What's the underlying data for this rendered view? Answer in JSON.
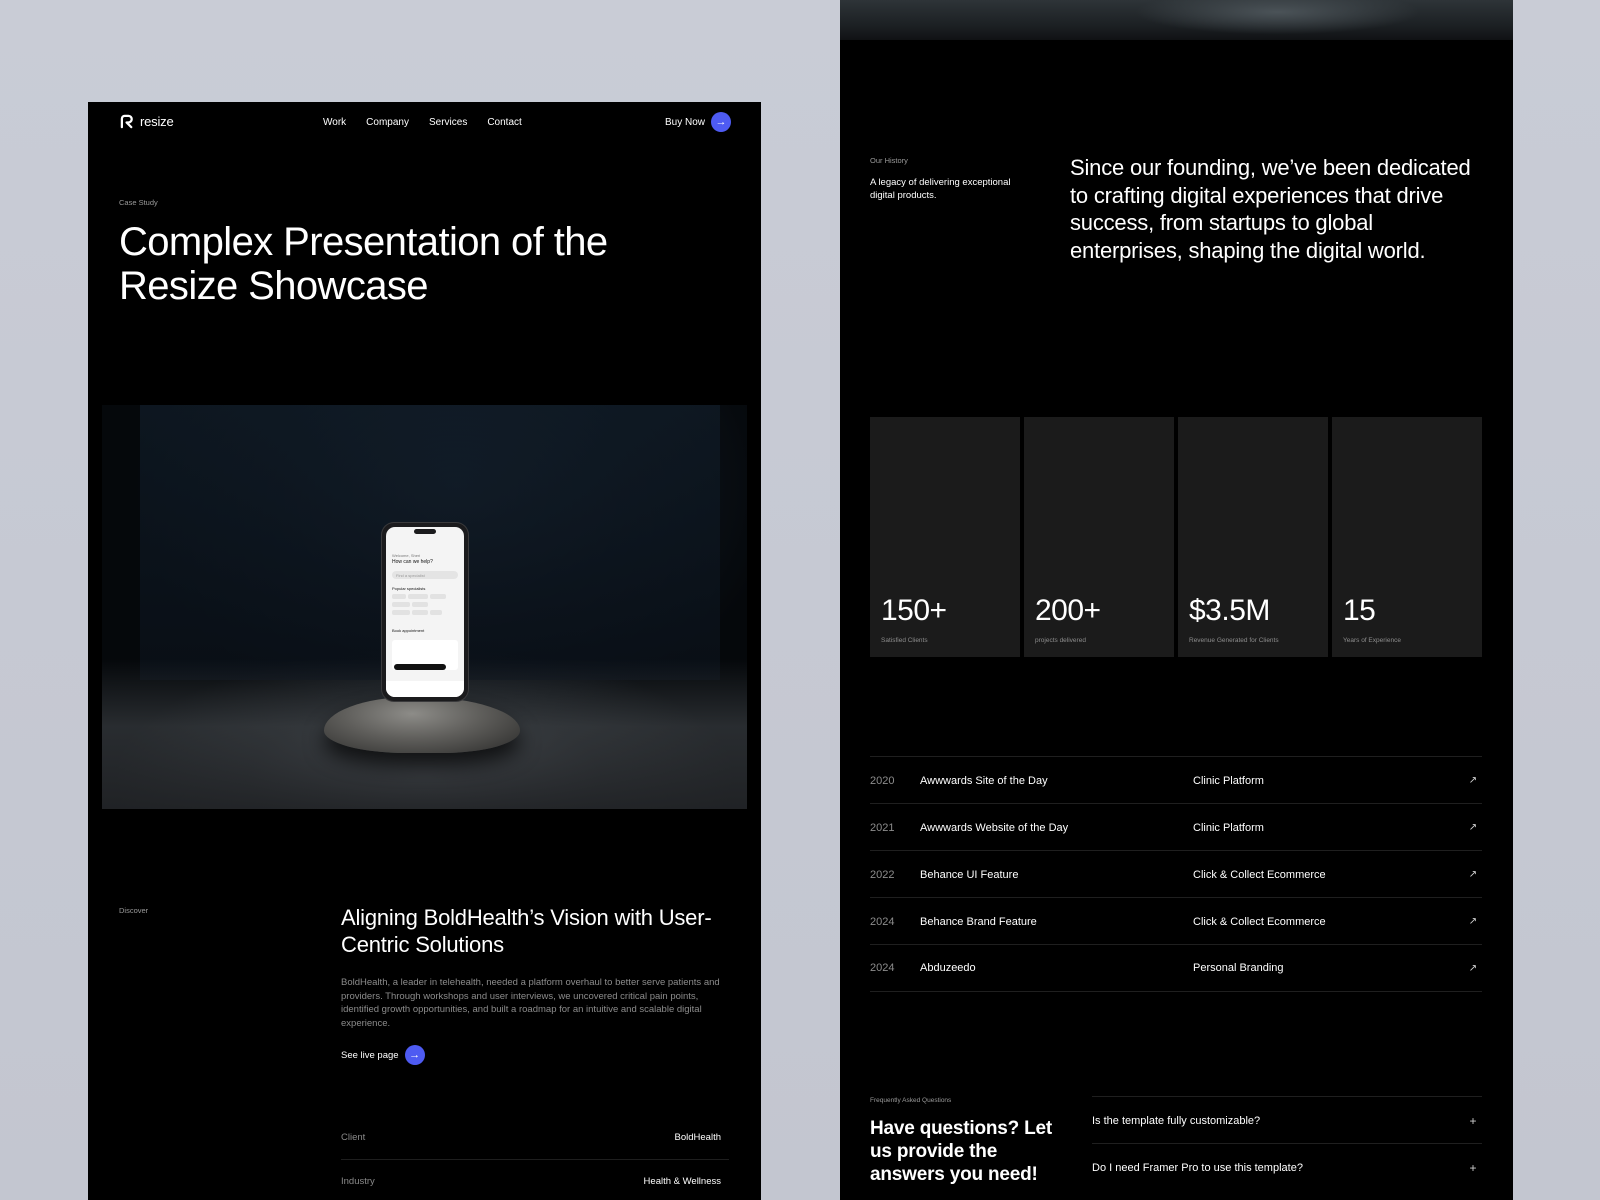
{
  "brand": {
    "name": "resize",
    "accent": "#4e5bf2"
  },
  "nav": {
    "items": [
      "Work",
      "Company",
      "Services",
      "Contact"
    ],
    "cta": "Buy Now"
  },
  "hero": {
    "eyebrow": "Case Study",
    "title": "Complex Presentation of the Resize Showcase"
  },
  "phone_screen": {
    "greeting": "Welcome, Sheri",
    "question": "How can we help?",
    "search_placeholder": "Find a specialist",
    "section1": "Popular specialists",
    "section2": "Book appointment"
  },
  "discover": {
    "eyebrow": "Discover",
    "title": "Aligning BoldHealth’s Vision with User-Centric Solutions",
    "description": "BoldHealth, a leader in telehealth, needed a platform overhaul to better serve patients and providers. Through workshops and user interviews, we uncovered critical pain points, identified growth opportunities, and built a roadmap for an intuitive and scalable digital experience.",
    "link": "See live page",
    "details": [
      {
        "key": "Client",
        "value": "BoldHealth"
      },
      {
        "key": "Industry",
        "value": "Health & Wellness"
      }
    ]
  },
  "history": {
    "eyebrow": "Our History",
    "note": "A legacy of delivering exceptional digital products.",
    "statement": "Since our founding, we’ve been dedicated to crafting digital experiences that drive success, from startups to global enterprises, shaping the digital world."
  },
  "stats": [
    {
      "value": "150+",
      "label": "Satisfied Clients"
    },
    {
      "value": "200+",
      "label": "projects delivered"
    },
    {
      "value": "$3.5M",
      "label": "Revenue Generated for Clients"
    },
    {
      "value": "15",
      "label": "Years of Experience"
    }
  ],
  "awards": [
    {
      "year": "2020",
      "title": "Awwwards Site of the Day",
      "project": "Clinic Platform"
    },
    {
      "year": "2021",
      "title": "Awwwards Website of the Day",
      "project": "Clinic Platform"
    },
    {
      "year": "2022",
      "title": "Behance UI Feature",
      "project": "Click & Collect Ecommerce"
    },
    {
      "year": "2024",
      "title": "Behance Brand Feature",
      "project": "Click & Collect Ecommerce"
    },
    {
      "year": "2024",
      "title": "Abduzeedo",
      "project": "Personal Branding"
    }
  ],
  "faq": {
    "eyebrow": "Frequently Asked Questions",
    "title": "Have questions? Let us provide the answers you need!",
    "questions": [
      "Is the template fully customizable?",
      "Do I need Framer Pro to use this template?"
    ]
  }
}
